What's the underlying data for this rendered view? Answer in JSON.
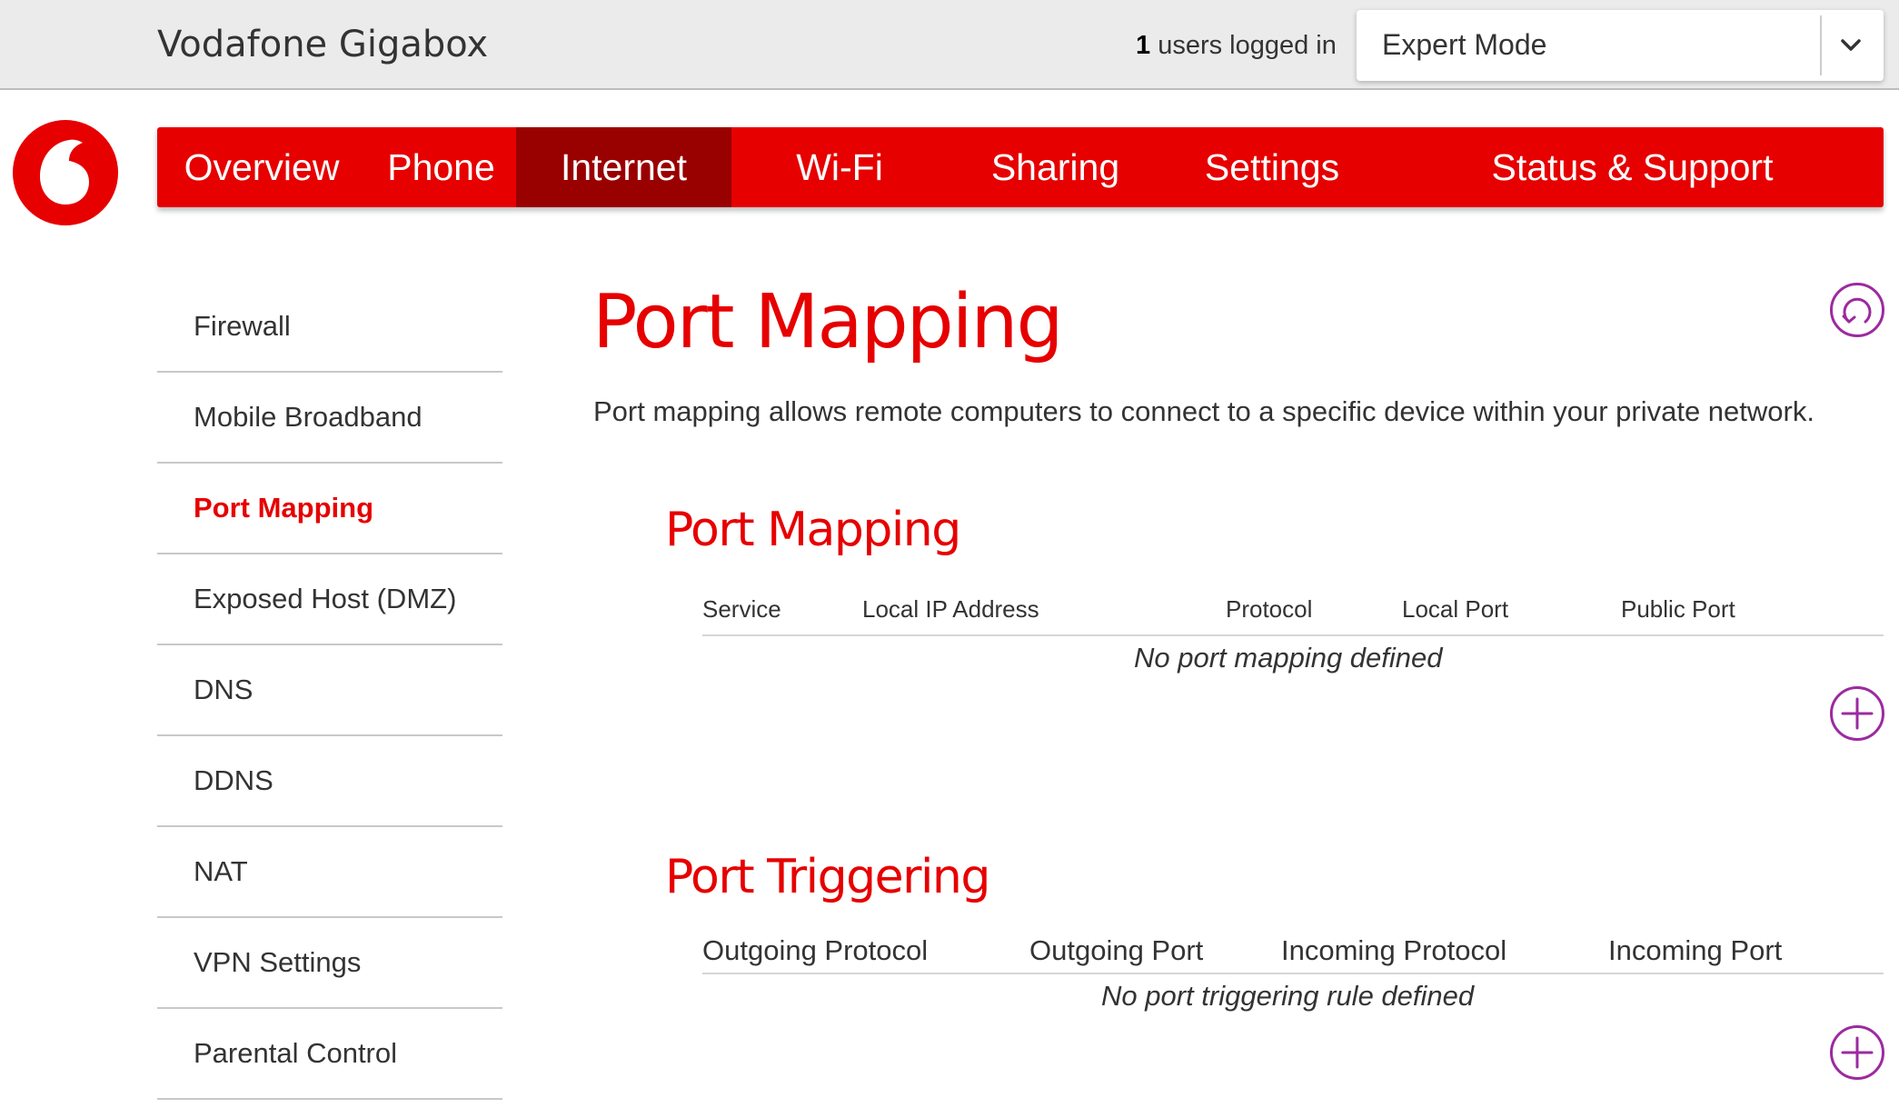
{
  "header": {
    "brand": "Vodafone Gigabox",
    "users_count": "1",
    "users_text": " users logged in",
    "mode_select": {
      "value": "Expert Mode"
    }
  },
  "nav": {
    "items": [
      {
        "label": "Overview"
      },
      {
        "label": "Phone"
      },
      {
        "label": "Internet"
      },
      {
        "label": "Wi-Fi"
      },
      {
        "label": "Sharing"
      },
      {
        "label": "Settings"
      },
      {
        "label": "Status & Support"
      }
    ],
    "active": "Internet"
  },
  "sidebar": {
    "items": [
      {
        "label": "Firewall"
      },
      {
        "label": "Mobile Broadband"
      },
      {
        "label": "Port Mapping"
      },
      {
        "label": "Exposed Host (DMZ)"
      },
      {
        "label": "DNS"
      },
      {
        "label": "DDNS"
      },
      {
        "label": "NAT"
      },
      {
        "label": "VPN Settings"
      },
      {
        "label": "Parental Control"
      }
    ],
    "active": "Port Mapping"
  },
  "page": {
    "title": "Port Mapping",
    "description": "Port mapping allows remote computers to connect to a specific device within your private network."
  },
  "port_mapping": {
    "title": "Port Mapping",
    "columns": [
      "Service",
      "Local IP Address",
      "Protocol",
      "Local Port",
      "Public Port"
    ],
    "empty_text": "No port mapping defined"
  },
  "port_triggering": {
    "title": "Port Triggering",
    "columns": [
      "Outgoing Protocol",
      "Outgoing Port",
      "Incoming Protocol",
      "Incoming Port"
    ],
    "empty_text": "No port triggering rule defined"
  },
  "icons": {
    "logo": "vodafone-logo",
    "dropdown": "chevron-down-icon",
    "refresh": "refresh-icon",
    "add": "plus-circle-icon"
  },
  "colors": {
    "brand_red": "#e60000",
    "nav_active": "#990000",
    "icon_purple": "#9c2aa0"
  }
}
